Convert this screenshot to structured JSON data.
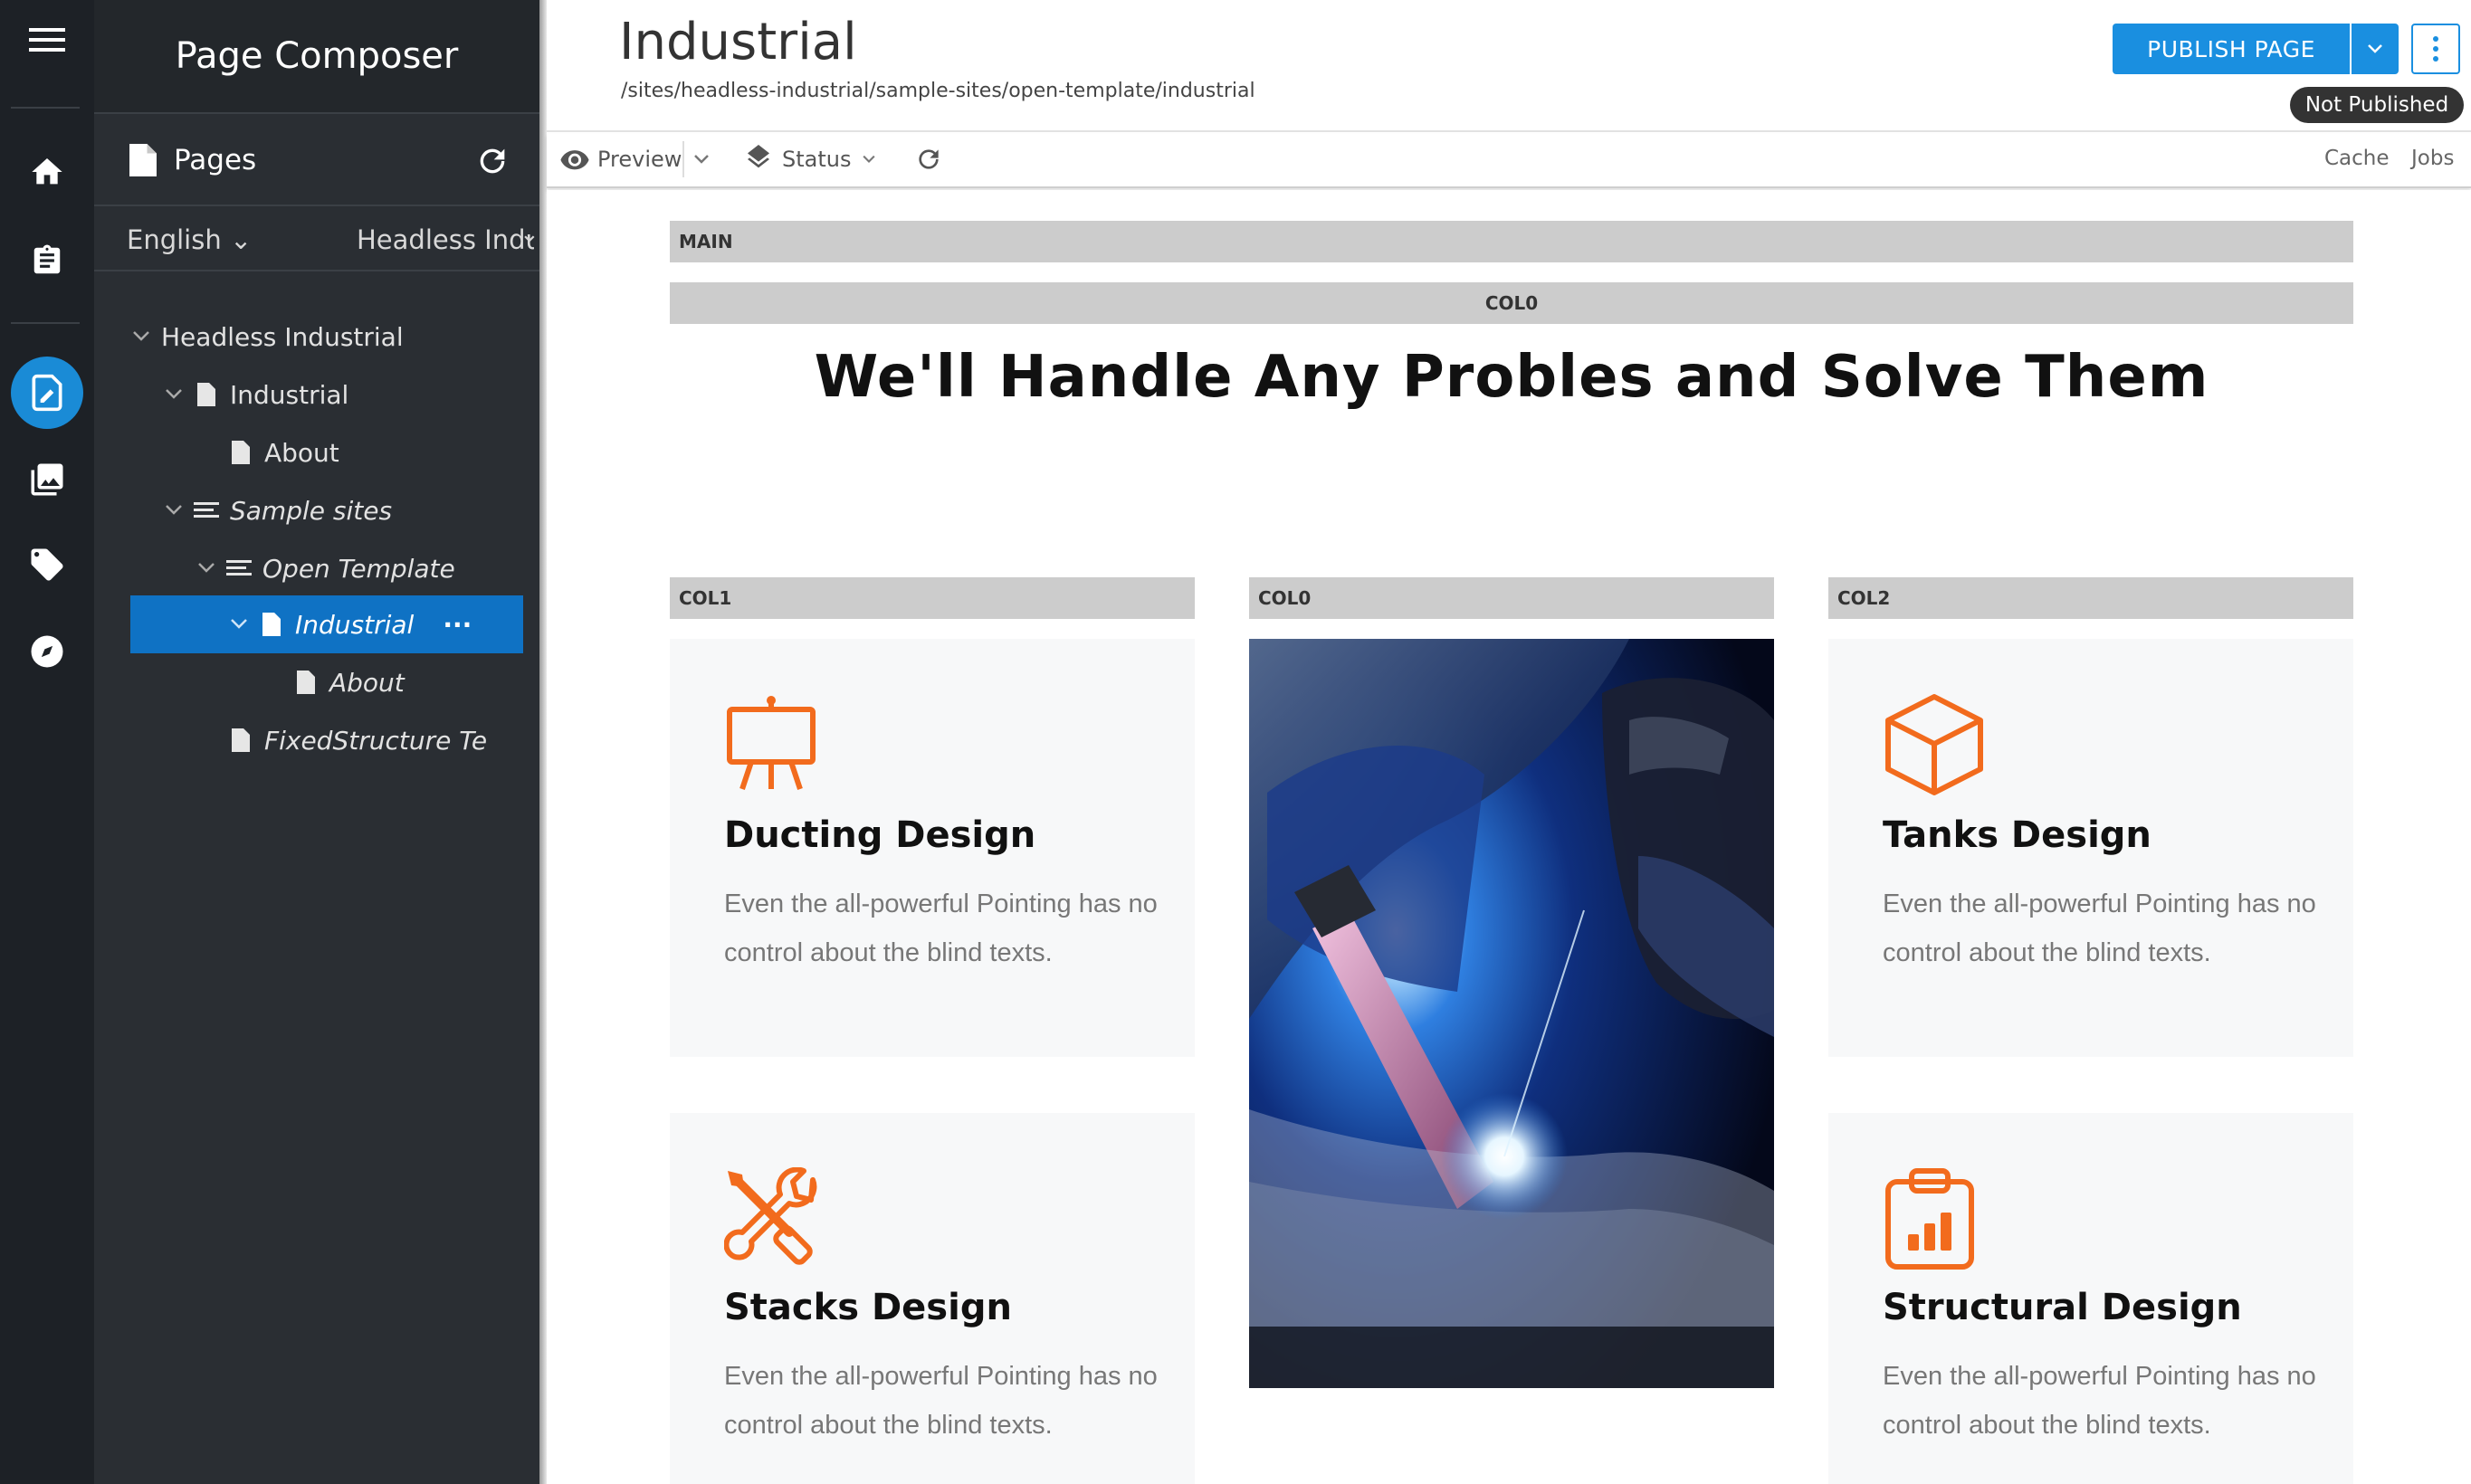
{
  "rail": {
    "items": [
      {
        "name": "menu-icon"
      },
      {
        "name": "home-icon"
      },
      {
        "name": "clipboard-icon"
      },
      {
        "name": "page-composer-icon",
        "active": true
      },
      {
        "name": "media-icon"
      },
      {
        "name": "tag-icon"
      },
      {
        "name": "compass-icon"
      }
    ],
    "active_color": "#1a8bd6"
  },
  "sidebar": {
    "title": "Page Composer",
    "pages_label": "Pages",
    "language": "English",
    "site": "Headless Industrial",
    "tree": [
      {
        "label": "Headless Industrial",
        "level": 0,
        "expanded": true,
        "icon": "none"
      },
      {
        "label": "Industrial",
        "level": 1,
        "expanded": true,
        "icon": "page-icon"
      },
      {
        "label": "About",
        "level": 2,
        "icon": "page-icon"
      },
      {
        "label": "Sample sites",
        "level": 1,
        "expanded": true,
        "icon": "list-icon",
        "italic": true
      },
      {
        "label": "Open Template",
        "level": 2,
        "expanded": true,
        "icon": "list-icon",
        "italic": true
      },
      {
        "label": "Industrial",
        "level": 3,
        "expanded": true,
        "icon": "page-icon",
        "italic": true,
        "selected": true,
        "more": "···"
      },
      {
        "label": "About",
        "level": 4,
        "icon": "page-icon",
        "italic": true
      },
      {
        "label": "FixedStructure Te",
        "level": 2,
        "icon": "page-icon",
        "italic": true
      }
    ],
    "selected_color": "#0f72c4"
  },
  "header": {
    "page_name": "Industrial",
    "path": "/sites/headless-industrial/sample-sites/open-template/industrial",
    "publish_label": "PUBLISH PAGE",
    "status_badge": "Not Published",
    "accent": "#1a8fe0"
  },
  "toolbar": {
    "preview_label": "Preview",
    "status_label": "Status",
    "cache_label": "Cache",
    "jobs_label": "Jobs"
  },
  "canvas": {
    "main_label": "MAIN",
    "col0_label": "COL0",
    "headline": "We'll Handle Any Probles and Solve Them",
    "col1_label": "COL1",
    "col0b_label": "COL0",
    "col2_label": "COL2",
    "icon_color": "#f26b1d",
    "cards": [
      {
        "title": "Ducting Design",
        "text": "Even the all-powerful Pointing has no control about the blind texts.",
        "icon": "easel-icon"
      },
      {
        "title": "Tanks Design",
        "text": "Even the all-powerful Pointing has no control about the blind texts.",
        "icon": "cube-icon"
      },
      {
        "title": "Stacks Design",
        "text": "Even the all-powerful Pointing has no control about the blind texts.",
        "icon": "tools-icon"
      },
      {
        "title": "Structural Design",
        "text": "Even the all-powerful Pointing has no control about the blind texts.",
        "icon": "clipboard-chart-icon"
      }
    ],
    "photo": "welding-photo"
  }
}
